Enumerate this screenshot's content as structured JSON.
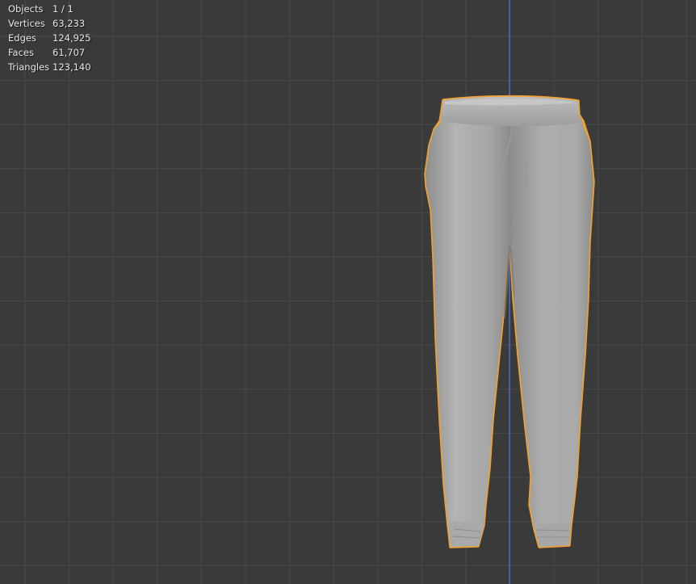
{
  "viewport": {
    "background_color": "#3a3a3a",
    "grid_line_color": "#4a4a4a",
    "axis_line_color": "#4a6bbd",
    "selection_outline_color": "#f0a030",
    "mesh_color": "#a8a8a8"
  },
  "statistics": {
    "rows": [
      {
        "label": "Objects",
        "value": "1 / 1"
      },
      {
        "label": "Vertices",
        "value": "63,233"
      },
      {
        "label": "Edges",
        "value": "124,925"
      },
      {
        "label": "Faces",
        "value": "61,707"
      },
      {
        "label": "Triangles",
        "value": "123,140"
      }
    ]
  },
  "selected_object": {
    "icon": "sweatpants-mesh"
  }
}
